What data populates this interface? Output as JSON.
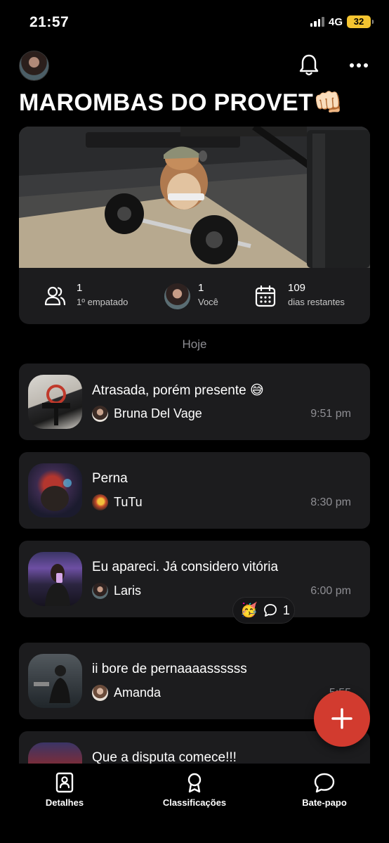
{
  "status_bar": {
    "time": "21:57",
    "network": "4G",
    "battery": "32"
  },
  "header": {
    "title": "MAROMBAS DO PROVET",
    "title_emoji": "👊🏻",
    "icons": [
      "bell-icon",
      "more-icon"
    ]
  },
  "stats": [
    {
      "value": "1",
      "label": "1º empatado",
      "icon": "users-icon"
    },
    {
      "value": "1",
      "label": "Você",
      "icon": "avatar"
    },
    {
      "value": "109",
      "label": "dias restantes",
      "icon": "calendar-icon"
    }
  ],
  "section_label": "Hoje",
  "posts": [
    {
      "title": "Atrasada, porém presente 😅",
      "user": "Bruna Del Vage",
      "time": "9:51 pm"
    },
    {
      "title": "Perna",
      "user": "TuTu",
      "time": "8:30 pm"
    },
    {
      "title": "Eu apareci. Já considero vitória",
      "user": "Laris",
      "time": "6:00 pm"
    },
    {
      "title": "ii bore de pernaaaassssss",
      "user": "Amanda",
      "time": "5:55"
    },
    {
      "title": "Que a disputa comece!!!",
      "user": "",
      "time": ""
    }
  ],
  "reaction": {
    "emoji": "🥳",
    "count": "1"
  },
  "tabs": [
    {
      "label": "Detalhes",
      "icon": "profile-book-icon"
    },
    {
      "label": "Classificações",
      "icon": "ribbon-icon"
    },
    {
      "label": "Bate-papo",
      "icon": "chat-bubble-icon"
    }
  ],
  "colors": {
    "background": "#000000",
    "card": "#1c1c1e",
    "fab": "#d23b2f",
    "muted": "#8e8e93",
    "battery": "#f4c430"
  }
}
